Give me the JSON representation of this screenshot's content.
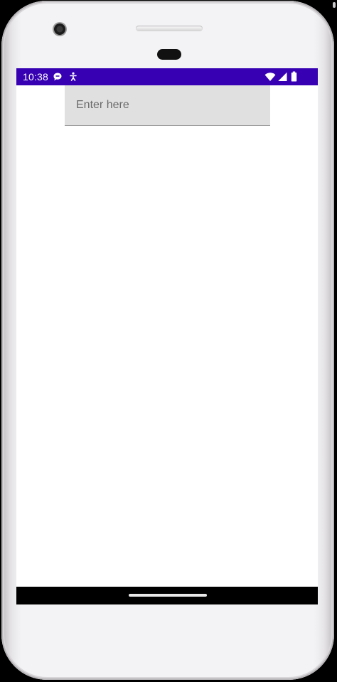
{
  "status_bar": {
    "time": "10:38",
    "background_color": "#3700b3",
    "left_icons": [
      "chat-notification-icon",
      "accessibility-notification-icon"
    ],
    "right_icons": [
      "wifi-icon",
      "cellular-signal-icon",
      "battery-icon"
    ]
  },
  "main": {
    "input": {
      "placeholder": "Enter here",
      "value": ""
    }
  },
  "nav_bar": {
    "background_color": "#000000"
  }
}
